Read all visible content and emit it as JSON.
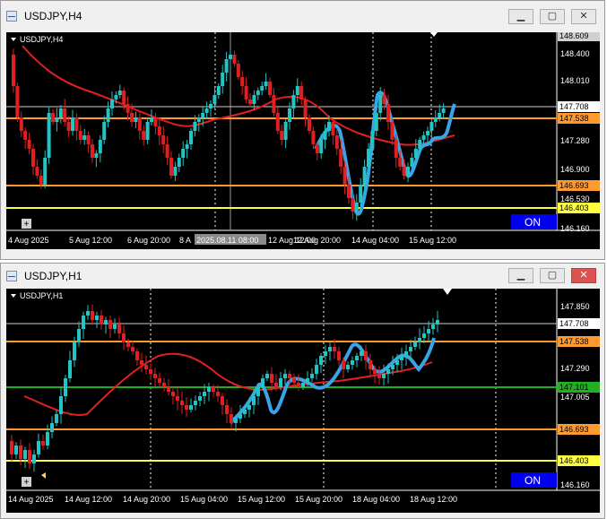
{
  "window_top": {
    "title": "USDJPY,H4",
    "chart_label": "USDJPY,H4",
    "on_label": "ON",
    "crosshair_time": "2025.08.11 08:00",
    "price_scale": [
      "148.609",
      "148.400",
      "148.010",
      "147.708",
      "147.538",
      "147.280",
      "146.900",
      "146.693",
      "146.530",
      "146.403",
      "146.160"
    ],
    "time_scale": [
      "4 Aug 2025",
      "5 Aug 12:00",
      "6 Aug 20:00",
      "8 A",
      "12 Aug 12:00",
      "12 Aug 20:00",
      "14 Aug 04:00",
      "15 Aug 12:00"
    ],
    "levels": {
      "current": "147.708",
      "orange_mid": "147.538",
      "orange_low": "146.693",
      "yellow_low": "146.403",
      "top": "148.609"
    }
  },
  "window_bottom": {
    "title": "USDJPY,H1",
    "chart_label": "USDJPY,H1",
    "on_label": "ON",
    "price_scale": [
      "147.850",
      "147.708",
      "147.538",
      "147.290",
      "147.101",
      "147.005",
      "146.693",
      "146.403",
      "146.160"
    ],
    "time_scale": [
      "14 Aug 2025",
      "14 Aug 12:00",
      "14 Aug 20:00",
      "15 Aug 04:00",
      "15 Aug 12:00",
      "15 Aug 20:00",
      "18 Aug 04:00",
      "18 Aug 12:00"
    ],
    "levels": {
      "current": "147.708",
      "orange_mid": "147.538",
      "green": "147.101",
      "orange_low": "146.693",
      "yellow_low": "146.403"
    }
  },
  "colors": {
    "bull": "#22c4c4",
    "bear": "#e02020",
    "ma_red": "#e02020",
    "ma_blue": "#3aa4e8",
    "orange": "#ff9a30",
    "yellow": "#ffff40",
    "green": "#20b020",
    "on_badge": "#0000ee"
  },
  "icons": [
    "chart-window-icon",
    "minimize-icon",
    "restore-icon",
    "close-icon"
  ]
}
